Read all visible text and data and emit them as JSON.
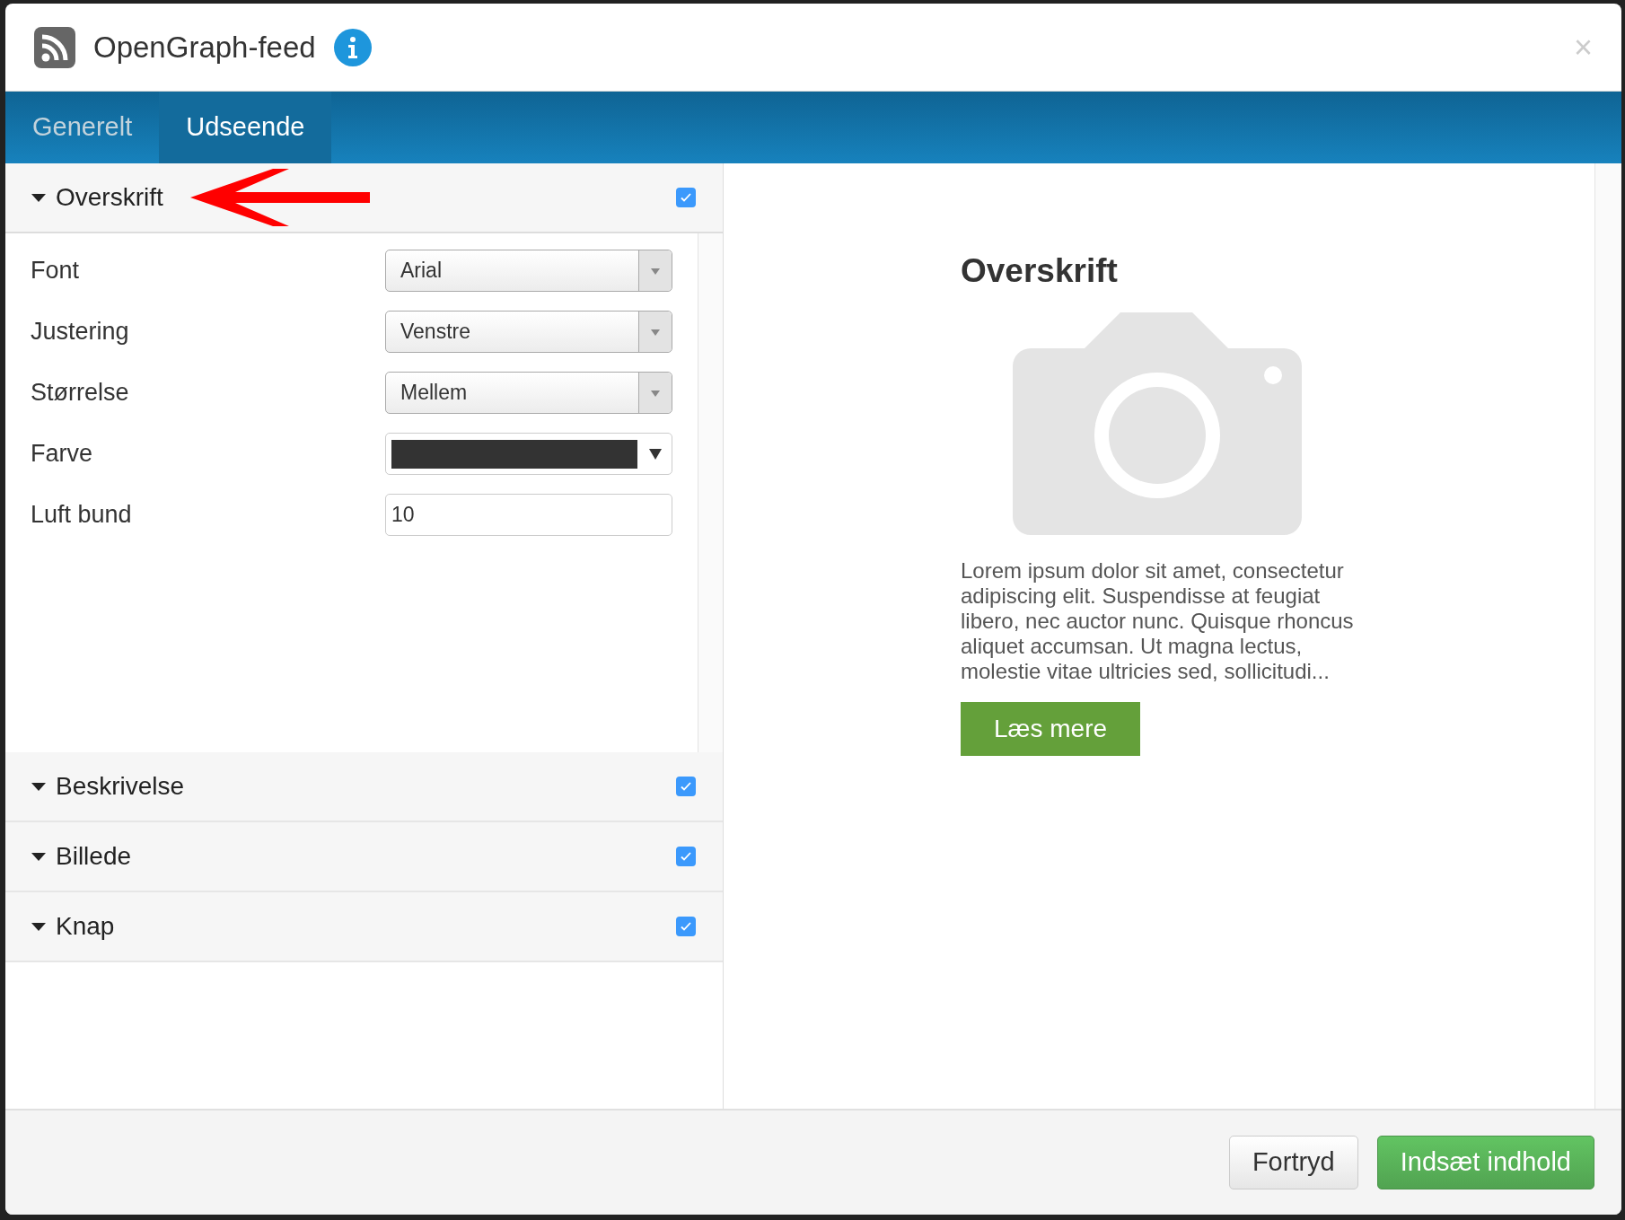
{
  "dialog": {
    "title": "OpenGraph-feed",
    "close": "×"
  },
  "tabs": [
    {
      "label": "Generelt",
      "selected": false
    },
    {
      "label": "Udseende",
      "selected": true
    }
  ],
  "sections": [
    {
      "title": "Overskrift",
      "expanded": true,
      "checked": true,
      "fields": [
        {
          "kind": "select",
          "label": "Font",
          "value": "Arial"
        },
        {
          "kind": "select",
          "label": "Justering",
          "value": "Venstre"
        },
        {
          "kind": "select",
          "label": "Størrelse",
          "value": "Mellem"
        },
        {
          "kind": "color",
          "label": "Farve",
          "color": "#333333"
        },
        {
          "kind": "input",
          "label": "Luft bund",
          "value": "10"
        }
      ]
    },
    {
      "title": "Beskrivelse",
      "expanded": false,
      "checked": true
    },
    {
      "title": "Billede",
      "expanded": false,
      "checked": true
    },
    {
      "title": "Knap",
      "expanded": false,
      "checked": true
    }
  ],
  "preview": {
    "heading": "Overskrift",
    "text": "Lorem ipsum dolor sit amet, consectetur adipiscing elit. Suspendisse at feugiat libero, nec auctor nunc. Quisque rhoncus aliquet accumsan. Ut magna lectus, molestie vitae ultricies sed, sollicitudi...",
    "button": "Læs mere"
  },
  "footer": {
    "buttons": [
      {
        "label": "Fortryd",
        "kind": "secondary"
      },
      {
        "label": "Indsæt indhold",
        "kind": "primary"
      }
    ]
  }
}
